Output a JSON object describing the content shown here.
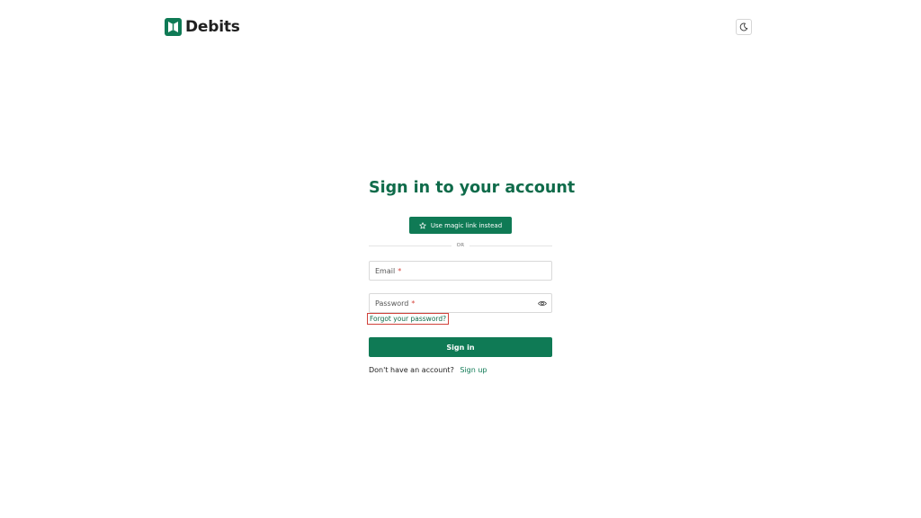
{
  "header": {
    "logo_text": "Debits",
    "theme_toggle_icon": "moon-icon"
  },
  "form": {
    "title": "Sign in to your account",
    "magic_link_label": "Use magic link instead",
    "magic_link_icon": "star-icon",
    "divider_text": "OR",
    "email": {
      "label": "Email",
      "required_mark": "*"
    },
    "password": {
      "label": "Password",
      "required_mark": "*",
      "toggle_icon": "eye-icon"
    },
    "forgot_password_label": "Forgot your password?",
    "signin_label": "Sign in",
    "signup_prompt": "Don't have an account?",
    "signup_label": "Sign up"
  },
  "colors": {
    "brand": "#0f7a55",
    "title": "#0f6b4a",
    "required": "#d6453d",
    "highlight_border": "#d0413a"
  }
}
